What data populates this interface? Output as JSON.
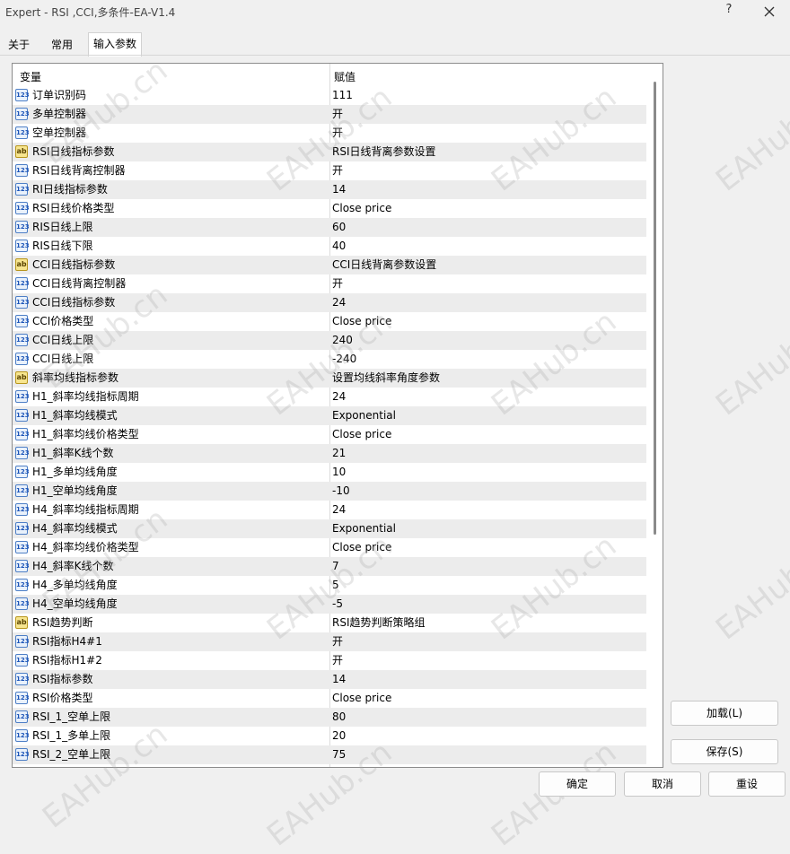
{
  "window": {
    "title": "Expert - RSI ,CCI,多条件-EA-V1.4",
    "help_label": "?"
  },
  "tabs": [
    {
      "label": "关于"
    },
    {
      "label": "常用"
    },
    {
      "label": "输入参数",
      "active": true
    }
  ],
  "grid": {
    "columns": {
      "variable": "变量",
      "value": "赋值"
    },
    "rows": [
      {
        "icon": "number-type-icon",
        "badge": "123",
        "name": "订单识别码",
        "value": "111"
      },
      {
        "icon": "number-type-icon",
        "badge": "123",
        "name": "多单控制器",
        "value": "开"
      },
      {
        "icon": "number-type-icon",
        "badge": "123",
        "name": "空单控制器",
        "value": "开"
      },
      {
        "icon": "string-type-icon",
        "badge": "ab",
        "name": "RSI日线指标参数",
        "value": "RSI日线背离参数设置"
      },
      {
        "icon": "number-type-icon",
        "badge": "123",
        "name": "RSI日线背离控制器",
        "value": "开"
      },
      {
        "icon": "number-type-icon",
        "badge": "123",
        "name": "RI日线指标参数",
        "value": "14"
      },
      {
        "icon": "number-type-icon",
        "badge": "123",
        "name": "RSI日线价格类型",
        "value": "Close price"
      },
      {
        "icon": "number-type-icon",
        "badge": "123",
        "name": "RIS日线上限",
        "value": "60"
      },
      {
        "icon": "number-type-icon",
        "badge": "123",
        "name": "RIS日线下限",
        "value": "40"
      },
      {
        "icon": "string-type-icon",
        "badge": "ab",
        "name": "CCI日线指标参数",
        "value": "CCI日线背离参数设置"
      },
      {
        "icon": "number-type-icon",
        "badge": "123",
        "name": "CCI日线背离控制器",
        "value": "开"
      },
      {
        "icon": "number-type-icon",
        "badge": "123",
        "name": "CCI日线指标参数",
        "value": "24"
      },
      {
        "icon": "number-type-icon",
        "badge": "123",
        "name": "CCI价格类型",
        "value": "Close price"
      },
      {
        "icon": "number-type-icon",
        "badge": "123",
        "name": "CCI日线上限",
        "value": "240"
      },
      {
        "icon": "number-type-icon",
        "badge": "123",
        "name": "CCI日线上限",
        "value": "-240"
      },
      {
        "icon": "string-type-icon",
        "badge": "ab",
        "name": "斜率均线指标参数",
        "value": "设置均线斜率角度参数"
      },
      {
        "icon": "number-type-icon",
        "badge": "123",
        "name": "H1_斜率均线指标周期",
        "value": "24"
      },
      {
        "icon": "number-type-icon",
        "badge": "123",
        "name": "H1_斜率均线模式",
        "value": "Exponential"
      },
      {
        "icon": "number-type-icon",
        "badge": "123",
        "name": "H1_斜率均线价格类型",
        "value": "Close price"
      },
      {
        "icon": "number-type-icon",
        "badge": "123",
        "name": "H1_斜率K线个数",
        "value": "21"
      },
      {
        "icon": "number-type-icon",
        "badge": "123",
        "name": "H1_多单均线角度",
        "value": "10"
      },
      {
        "icon": "number-type-icon",
        "badge": "123",
        "name": "H1_空单均线角度",
        "value": "-10"
      },
      {
        "icon": "number-type-icon",
        "badge": "123",
        "name": "H4_斜率均线指标周期",
        "value": "24"
      },
      {
        "icon": "number-type-icon",
        "badge": "123",
        "name": "H4_斜率均线模式",
        "value": "Exponential"
      },
      {
        "icon": "number-type-icon",
        "badge": "123",
        "name": "H4_斜率均线价格类型",
        "value": "Close price"
      },
      {
        "icon": "number-type-icon",
        "badge": "123",
        "name": "H4_斜率K线个数",
        "value": "7"
      },
      {
        "icon": "number-type-icon",
        "badge": "123",
        "name": "H4_多单均线角度",
        "value": "5"
      },
      {
        "icon": "number-type-icon",
        "badge": "123",
        "name": "H4_空单均线角度",
        "value": "-5"
      },
      {
        "icon": "string-type-icon",
        "badge": "ab",
        "name": "RSI趋势判断",
        "value": "RSI趋势判断策略组"
      },
      {
        "icon": "number-type-icon",
        "badge": "123",
        "name": "RSI指标H4#1",
        "value": "开"
      },
      {
        "icon": "number-type-icon",
        "badge": "123",
        "name": "RSI指标H1#2",
        "value": "开"
      },
      {
        "icon": "number-type-icon",
        "badge": "123",
        "name": "RSI指标参数",
        "value": "14"
      },
      {
        "icon": "number-type-icon",
        "badge": "123",
        "name": "RSI价格类型",
        "value": "Close price"
      },
      {
        "icon": "number-type-icon",
        "badge": "123",
        "name": "RSI_1_空单上限",
        "value": "80"
      },
      {
        "icon": "number-type-icon",
        "badge": "123",
        "name": "RSI_1_多单上限",
        "value": "20"
      },
      {
        "icon": "number-type-icon",
        "badge": "123",
        "name": "RSI_2_空单上限",
        "value": "75"
      }
    ]
  },
  "side_buttons": {
    "load": "加载(L)",
    "save": "保存(S)"
  },
  "footer_buttons": {
    "ok": "确定",
    "cancel": "取消",
    "reset": "重设"
  },
  "watermark": {
    "text": "EAHub.cn"
  }
}
